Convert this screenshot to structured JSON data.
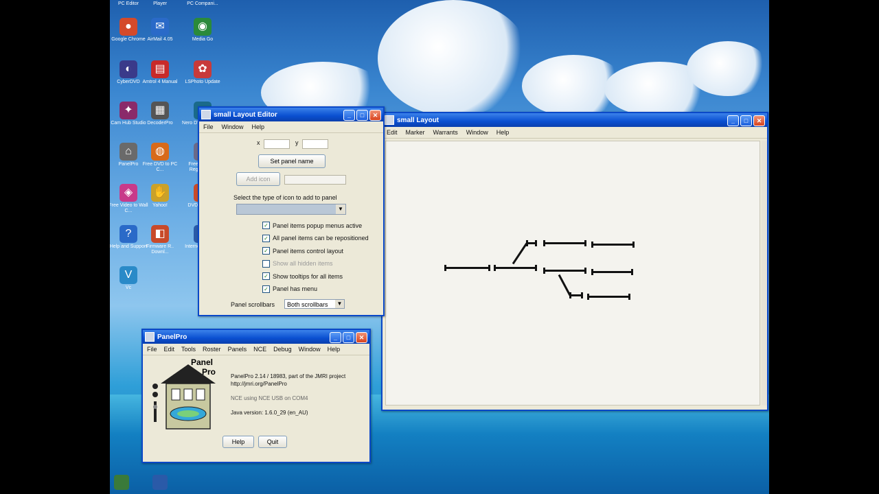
{
  "desktop": {
    "icons": [
      {
        "label": "PC Editor",
        "glyph": "✎",
        "color": "#5a6a8a"
      },
      {
        "label": "Player",
        "glyph": "▶",
        "color": "#4466aa"
      },
      {
        "label": "PC Compani...",
        "glyph": "◆",
        "color": "#3a6a9a"
      },
      {
        "label": "Google Chrome",
        "glyph": "●",
        "color": "#d44a2a"
      },
      {
        "label": "AirMail 4.05",
        "glyph": "✉",
        "color": "#2a6ac8"
      },
      {
        "label": "Media Go",
        "glyph": "◉",
        "color": "#2a8a3a"
      },
      {
        "label": "CyberDVD",
        "glyph": "◐",
        "color": "#3a3a8a"
      },
      {
        "label": "Amtrol 4 Manual",
        "glyph": "▤",
        "color": "#c82a2a"
      },
      {
        "label": "LSPhoto Update",
        "glyph": "✿",
        "color": "#c83a3a"
      },
      {
        "label": "Cam Hub Studio",
        "glyph": "✦",
        "color": "#8a2a6a"
      },
      {
        "label": "DecoderPro",
        "glyph": "▦",
        "color": "#555555"
      },
      {
        "label": "Nero DVD Encoder",
        "glyph": "■",
        "color": "#1a6a8a"
      },
      {
        "label": "PanelPro",
        "glyph": "⌂",
        "color": "#6a6a6a"
      },
      {
        "label": "Free DVD to PC C...",
        "glyph": "◍",
        "color": "#d86a1a"
      },
      {
        "label": "Free Window Registry R...",
        "glyph": "✂",
        "color": "#6a6a8a"
      },
      {
        "label": "Free Video to Wall C...",
        "glyph": "◈",
        "color": "#c83a8a"
      },
      {
        "label": "Yahoo!",
        "glyph": "✋",
        "color": "#caa12a"
      },
      {
        "label": "DVD Decoder",
        "glyph": "◎",
        "color": "#c84a2a"
      },
      {
        "label": "Help and Support",
        "glyph": "?",
        "color": "#2a6ac8"
      },
      {
        "label": "Firmware R.. Downl...",
        "glyph": "◧",
        "color": "#c84a2a"
      },
      {
        "label": "Internet Explorer",
        "glyph": "e",
        "color": "#2a5aa8"
      },
      {
        "label": "Vc",
        "glyph": "V",
        "color": "#2a8ac8"
      }
    ]
  },
  "layout_editor": {
    "title": "small Layout Editor",
    "menus": [
      "File",
      "Window",
      "Help"
    ],
    "x_label": "x",
    "y_label": "y",
    "set_panel_name": "Set panel name",
    "add_button": "Add icon",
    "select_type_label": "Select the type of icon to add to panel",
    "checkboxes": [
      {
        "label": "Panel items popup menus active",
        "checked": true
      },
      {
        "label": "All panel items can be repositioned",
        "checked": true
      },
      {
        "label": "Panel items control layout",
        "checked": true
      },
      {
        "label": "Show all hidden items",
        "checked": false
      },
      {
        "label": "Show tooltips for all items",
        "checked": true
      },
      {
        "label": "Panel has menu",
        "checked": true
      }
    ],
    "scrollbars_label": "Panel scrollbars",
    "scrollbars_value": "Both scrollbars"
  },
  "layout_panel": {
    "title": "small Layout",
    "menus": [
      "Edit",
      "Marker",
      "Warrants",
      "Window",
      "Help"
    ]
  },
  "panelpro": {
    "title": "PanelPro",
    "menus": [
      "File",
      "Edit",
      "Tools",
      "Roster",
      "Panels",
      "NCE",
      "Debug",
      "Window",
      "Help"
    ],
    "logo_text_1": "Panel",
    "logo_text_2": "Pro",
    "version_line": "PanelPro 2.14 / 18983, part of the JMRI project",
    "url_line": "http://jmri.org/PanelPro",
    "nce_line": "NCE using NCE USB on COM4",
    "java_line": "Java version: 1.6.0_29 (en_AU)",
    "help_button": "Help",
    "quit_button": "Quit"
  },
  "colors": {
    "titlebar": "#0a4fd0",
    "window_bg": "#ece9d8",
    "track": "#111111"
  }
}
